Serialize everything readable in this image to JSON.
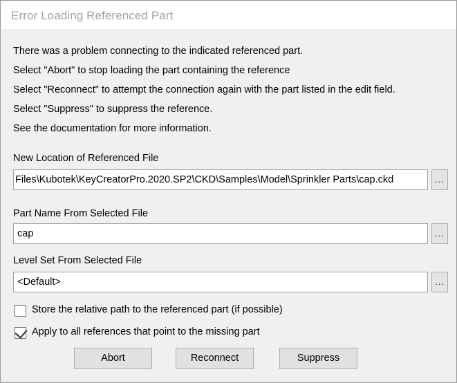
{
  "window": {
    "title": "Error Loading Referenced Part"
  },
  "message": {
    "lines": [
      "There was a problem connecting to the indicated referenced part.",
      "Select \"Abort\" to stop loading the part containing the reference",
      "Select \"Reconnect\" to attempt the connection again with the part listed in the edit field.",
      "Select \"Suppress\" to suppress the reference.",
      "See the documentation for more information."
    ]
  },
  "fields": [
    {
      "label": "New Location of Referenced File",
      "value": "Files\\Kubotek\\KeyCreatorPro.2020.SP2\\CKD\\Samples\\Model\\Sprinkler Parts\\cap.ckd",
      "browse_label": "..."
    },
    {
      "label": "Part Name From Selected File",
      "value": "cap",
      "browse_label": "..."
    },
    {
      "label": "Level Set From Selected File",
      "value": "<Default>",
      "browse_label": "..."
    }
  ],
  "checkboxes": [
    {
      "label": "Store the relative path to the referenced part (if possible)",
      "checked": false
    },
    {
      "label": "Apply to all references that point to the missing part",
      "checked": true
    }
  ],
  "buttons": [
    {
      "label": "Abort"
    },
    {
      "label": "Reconnect"
    },
    {
      "label": "Suppress"
    }
  ],
  "colors": {
    "window_bg": "#f0f0f0",
    "titlebar_bg": "#ffffff",
    "title_text": "#9ba3ad",
    "border": "#9b9b9b",
    "field_bg": "#ffffff",
    "field_border": "#a0a0a0",
    "button_bg": "#e1e1e1",
    "button_border": "#adadad",
    "text": "#000000"
  }
}
